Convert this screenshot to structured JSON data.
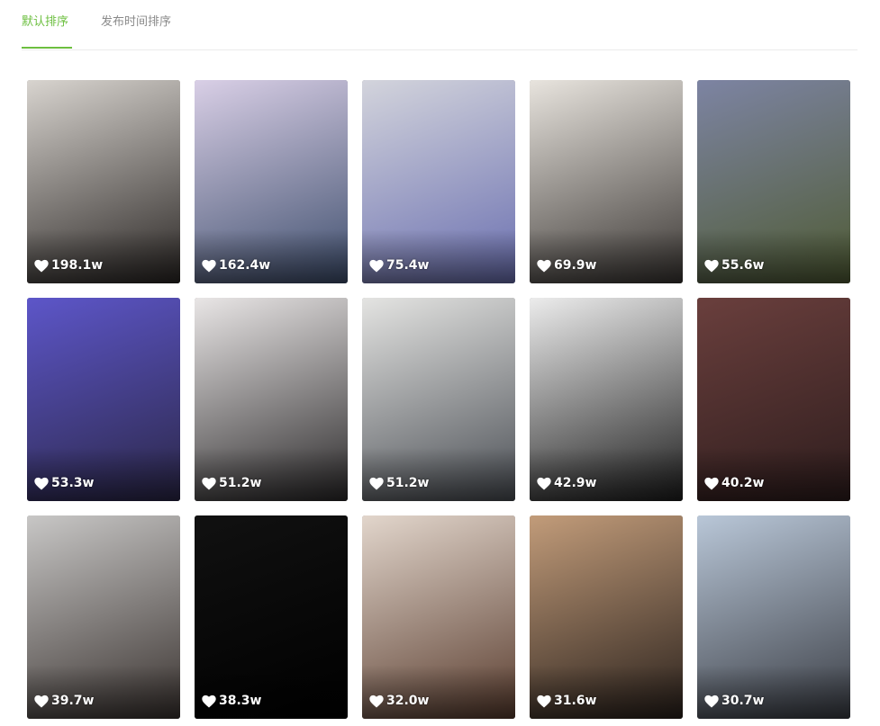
{
  "tabs": [
    {
      "label": "默认排序",
      "active": true
    },
    {
      "label": "发布时间排序",
      "active": false
    }
  ],
  "accent_color": "#6cbf3f",
  "like_icon": "heart-icon",
  "videos": [
    {
      "likes": "198.1w",
      "tone": [
        "#d8d4cf",
        "#2a2624"
      ]
    },
    {
      "likes": "162.4w",
      "tone": [
        "#d9cfe6",
        "#3f4f6e"
      ]
    },
    {
      "likes": "75.4w",
      "tone": [
        "#d3d4dc",
        "#6a6fb0"
      ]
    },
    {
      "likes": "69.9w",
      "tone": [
        "#e8e4de",
        "#3a3633"
      ]
    },
    {
      "likes": "55.6w",
      "tone": [
        "#7d84a3",
        "#4f5b34"
      ]
    },
    {
      "likes": "53.3w",
      "tone": [
        "#5d56c9",
        "#2b2748"
      ]
    },
    {
      "likes": "51.2w",
      "tone": [
        "#e9e6e6",
        "#2c2a2b"
      ]
    },
    {
      "likes": "51.2w",
      "tone": [
        "#e4e4e2",
        "#4b4f55"
      ]
    },
    {
      "likes": "42.9w",
      "tone": [
        "#ececec",
        "#1e1e1e"
      ]
    },
    {
      "likes": "40.2w",
      "tone": [
        "#6a3f3d",
        "#2e1d1d"
      ]
    },
    {
      "likes": "39.7w",
      "tone": [
        "#c8c7c6",
        "#3a3330"
      ]
    },
    {
      "likes": "38.3w",
      "tone": [
        "#111111",
        "#000000"
      ]
    },
    {
      "likes": "32.0w",
      "tone": [
        "#e2d6cc",
        "#5a3d2f"
      ]
    },
    {
      "likes": "31.6w",
      "tone": [
        "#c29c7a",
        "#2a211c"
      ]
    },
    {
      "likes": "30.7w",
      "tone": [
        "#b9c7d8",
        "#3a3d44"
      ]
    }
  ]
}
